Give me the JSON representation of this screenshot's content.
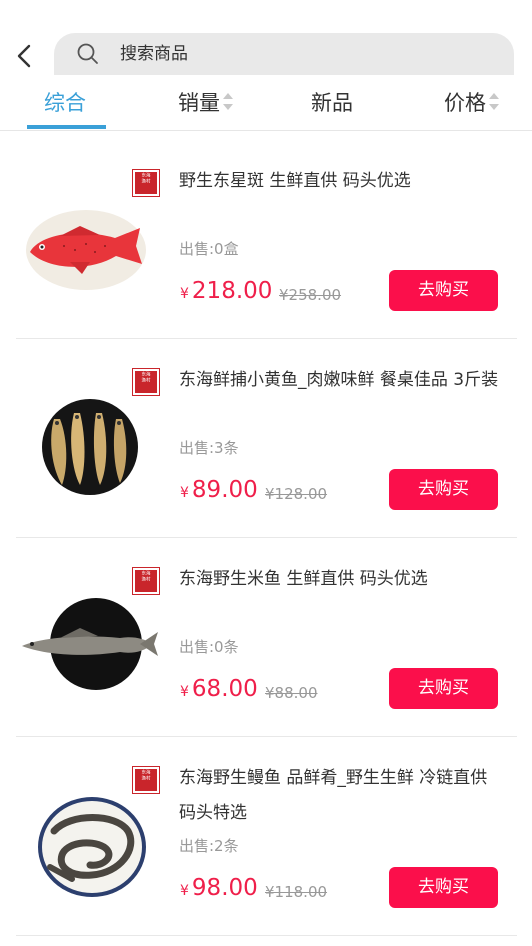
{
  "search": {
    "placeholder": "搜索商品"
  },
  "tabs": [
    {
      "label": "综合",
      "active": true
    },
    {
      "label": "销量",
      "sortable": true
    },
    {
      "label": "新品"
    },
    {
      "label": "价格",
      "sortable": true
    }
  ],
  "brand_seal_text": "东海渔村",
  "currency": "¥",
  "buy_label": "去购买",
  "colors": {
    "accent": "#3aa0d8",
    "price": "#ef1f4a",
    "buy_button": "#fb0f4b"
  },
  "products": [
    {
      "title": "野生东星斑 生鲜直供 码头优选",
      "sold": "出售:0盒",
      "price": "218.00",
      "old_price": "¥258.00",
      "image": "red-grouper-fish"
    },
    {
      "title": "东海鲜捕小黄鱼_肉嫩味鲜 餐桌佳品 3斤装",
      "sold": "出售:3条",
      "price": "89.00",
      "old_price": "¥128.00",
      "image": "yellow-croaker-plate"
    },
    {
      "title": "东海野生米鱼 生鲜直供 码头优选",
      "sold": "出售:0条",
      "price": "68.00",
      "old_price": "¥88.00",
      "image": "croaker-fish-black-plate"
    },
    {
      "title": "东海野生鳗鱼 品鲜肴_野生生鲜 冷链直供 码头特选",
      "sold": "出售:2条",
      "price": "98.00",
      "old_price": "¥118.00",
      "image": "eel-on-plate"
    }
  ]
}
